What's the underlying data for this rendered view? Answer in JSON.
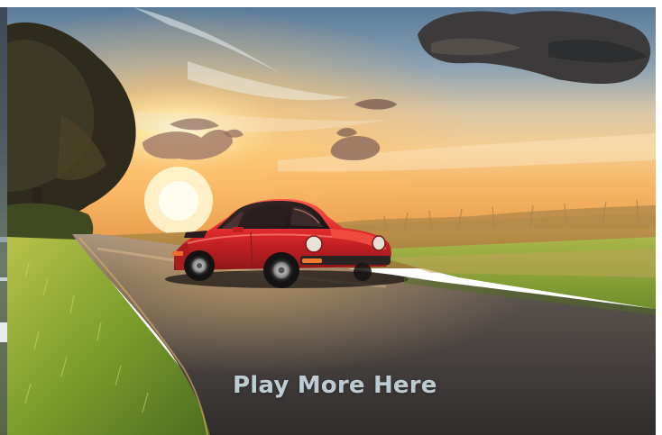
{
  "banner": {
    "cta_text": "Play More Here",
    "cta_color": "#d2e1eb",
    "scene_icon": "sports-car-sunset-image"
  },
  "palette": {
    "sky_top": "#5d7d9a",
    "sun": "#fff3c4",
    "car_body": "#d9262a",
    "grass": "#7ea02a",
    "road": "#3f3a38"
  }
}
